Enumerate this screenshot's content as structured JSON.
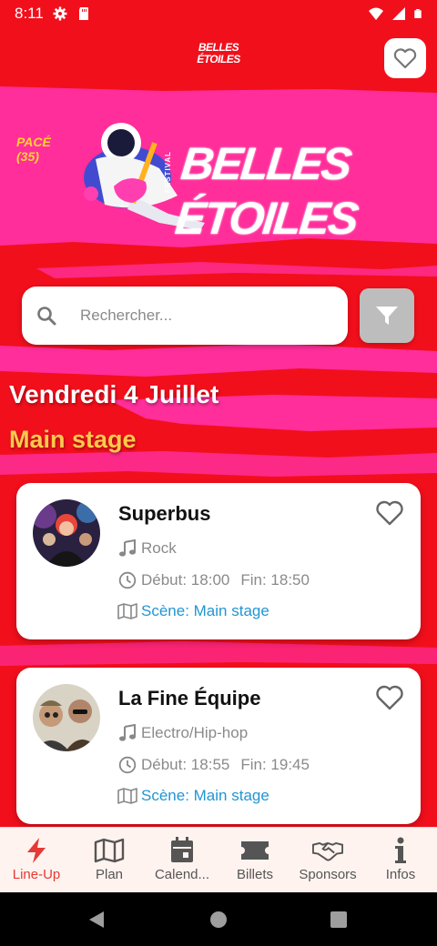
{
  "status_bar": {
    "time": "8:11"
  },
  "header": {
    "logo_line1": "BELLES",
    "logo_line2": "ÉTOILES"
  },
  "banner": {
    "place_line1": "PACÉ",
    "place_line2": "(35)",
    "festival_label": "FESTIVAL",
    "title": "BELLES ÉTOILES"
  },
  "search": {
    "placeholder": "Rechercher..."
  },
  "day": {
    "title": "Vendredi 4 Juillet",
    "stage": "Main stage"
  },
  "cards": [
    {
      "name": "Superbus",
      "genre": "Rock",
      "start": "Début: 18:00",
      "end": "Fin: 18:50",
      "stage": "Scène: Main stage"
    },
    {
      "name": "La Fine Équipe",
      "genre": "Electro/Hip-hop",
      "start": "Début: 18:55",
      "end": "Fin: 19:45",
      "stage": "Scène: Main stage"
    }
  ],
  "nav": [
    {
      "label": "Line-Up",
      "icon": "bolt-icon",
      "active": true
    },
    {
      "label": "Plan",
      "icon": "map-icon"
    },
    {
      "label": "Calend...",
      "icon": "calendar-icon"
    },
    {
      "label": "Billets",
      "icon": "ticket-icon"
    },
    {
      "label": "Sponsors",
      "icon": "handshake-icon"
    },
    {
      "label": "Infos",
      "icon": "info-icon"
    }
  ],
  "colors": {
    "background": "#f20f1c",
    "pink": "#ff2e9a",
    "stage_gold": "#ffc94d",
    "link_blue": "#2196d3",
    "active_red": "#e53935"
  }
}
